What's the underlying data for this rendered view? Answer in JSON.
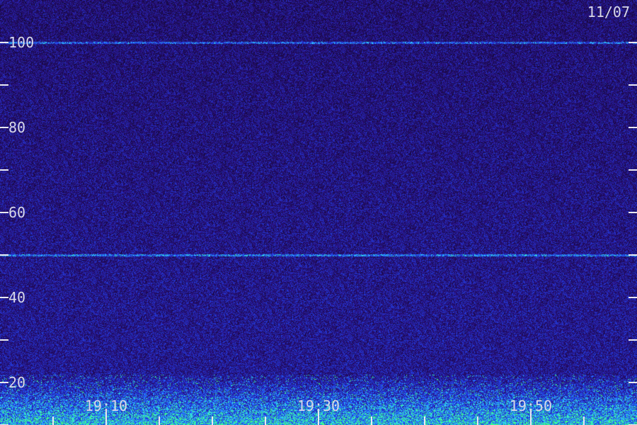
{
  "chart_data": {
    "type": "heatmap",
    "title": "",
    "date_label": "11/07",
    "xlabel": "",
    "ylabel": "",
    "ylim": [
      10,
      110
    ],
    "y_major_ticks": [
      20,
      40,
      60,
      80,
      100
    ],
    "y_minor_ticks": [
      10,
      30,
      50,
      70,
      90
    ],
    "y_tick_labels": [
      "20",
      "40",
      "60",
      "80",
      "100"
    ],
    "xlim_minutes": [
      "19:00",
      "20:00"
    ],
    "x_major_ticks": [
      "19:10",
      "19:30",
      "19:50"
    ],
    "x_tick_labels": [
      "19:10",
      "19:30",
      "19:50"
    ],
    "x_minor_tick_step_minutes": 5,
    "colormap": {
      "background": "#1a0e4a",
      "low": "#2a0f7a",
      "mid": "#2a3cff",
      "high": "#30e0ff",
      "peak": "#40ff80"
    },
    "features": [
      {
        "label": "narrow-band line",
        "y": 100
      },
      {
        "label": "narrow-band line",
        "y": 50
      },
      {
        "label": "strong low-frequency band",
        "y_range": [
          10,
          22
        ]
      }
    ]
  }
}
